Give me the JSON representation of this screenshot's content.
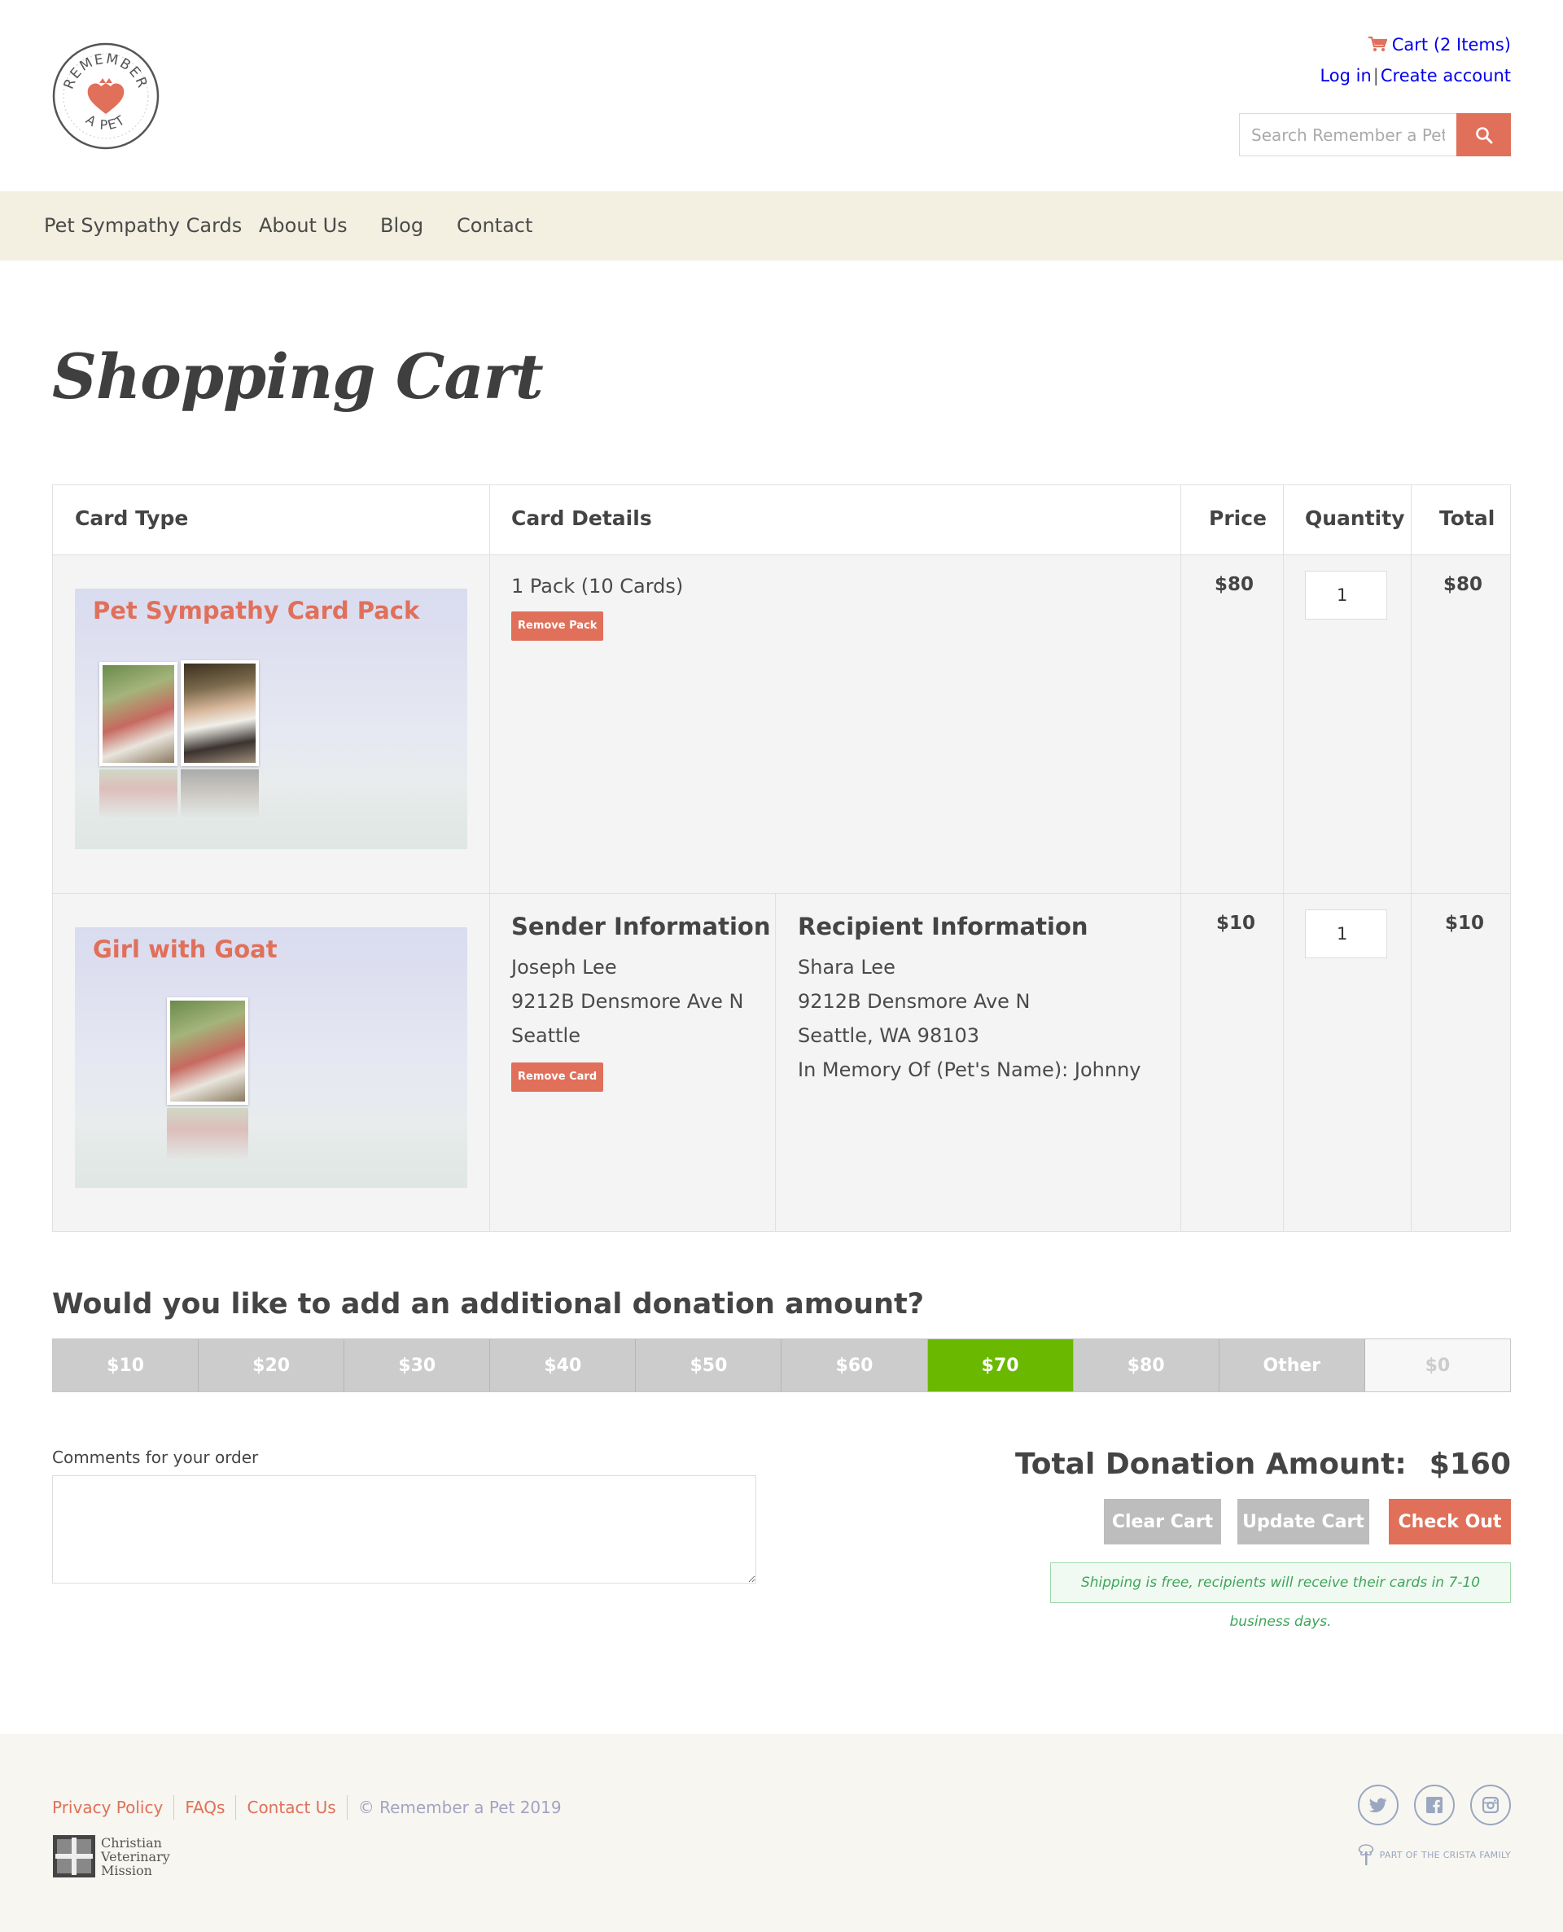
{
  "header": {
    "logo_text_top": "REMEMBER",
    "logo_text_bottom": "A PET",
    "cart_link": "Cart (2 Items)",
    "login_link": "Log in",
    "login_separator": "|",
    "create_account_link": "Create account",
    "search_placeholder": "Search Remember a Pet"
  },
  "nav": {
    "items": [
      "Pet Sympathy Cards",
      "About Us",
      "Blog",
      "Contact"
    ]
  },
  "page": {
    "title": "Shopping Cart"
  },
  "cart_table": {
    "headers": [
      "Card Type",
      "Card Details",
      "Price",
      "Quantity",
      "Total"
    ],
    "rows": [
      {
        "card_title": "Pet Sympathy Card Pack",
        "details": "1 Pack (10 Cards)",
        "remove_label": "Remove Pack",
        "price": "$80",
        "quantity": "1",
        "total": "$80"
      },
      {
        "card_title": "Girl with Goat",
        "sender_heading": "Sender Information",
        "sender_lines": [
          "Joseph Lee",
          "9212B Densmore Ave N",
          "Seattle"
        ],
        "remove_label": "Remove Card",
        "recipient_heading": "Recipient Information",
        "recipient_lines": [
          "Shara Lee",
          "9212B Densmore Ave N",
          "Seattle, WA 98103",
          "In Memory Of (Pet's Name): Johnny"
        ],
        "price": "$10",
        "quantity": "1",
        "total": "$10"
      }
    ]
  },
  "donation": {
    "question": "Would you like to add an additional donation amount?",
    "options": [
      "$10",
      "$20",
      "$30",
      "$40",
      "$50",
      "$60",
      "$70",
      "$80",
      "Other",
      "$0"
    ],
    "selected": "$70"
  },
  "order": {
    "comments_label": "Comments for your order",
    "total_label": "Total Donation Amount:",
    "total_amount": "$160",
    "clear_label": "Clear Cart",
    "update_label": "Update Cart",
    "checkout_label": "Check Out",
    "shipping_note": "Shipping is free, recipients will receive their cards in 7-10 business days."
  },
  "footer": {
    "links": [
      "Privacy Policy",
      "FAQs",
      "Contact Us"
    ],
    "copyright": "© Remember a Pet 2019",
    "cvm_lines": [
      "Christian",
      "Veterinary",
      "Mission"
    ],
    "crista": "PART OF THE CRISTA FAMILY",
    "social_icons": [
      "twitter-icon",
      "facebook-icon",
      "instagram-icon"
    ]
  },
  "colors": {
    "accent": "#e0705a",
    "nav_bg": "#f3f0e1",
    "donation_selected": "#6ab800",
    "donation_default": "#cccccc",
    "success_text": "#3fa55a"
  }
}
